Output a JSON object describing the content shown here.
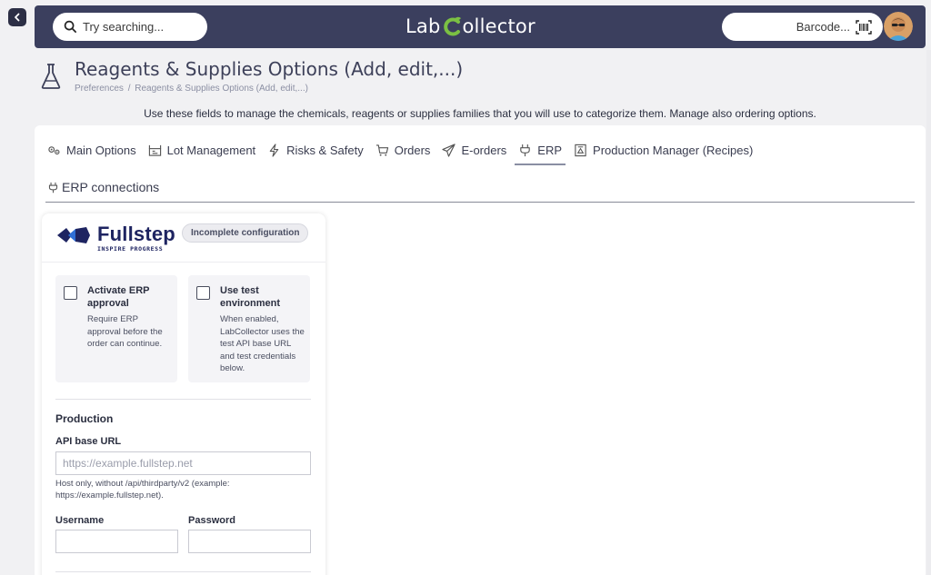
{
  "topbar": {
    "search_placeholder": "Try searching...",
    "logo_prefix": "Lab",
    "logo_suffix": "ollector",
    "barcode_placeholder": "Barcode..."
  },
  "page": {
    "title": "Reagents & Supplies Options (Add, edit,...)",
    "breadcrumb": [
      "Preferences",
      "/",
      "Reagents & Supplies Options (Add, edit,...)"
    ],
    "intro": "Use these fields to manage the chemicals, reagents or supplies families that you will use to categorize them. Manage also ordering options."
  },
  "tabs": [
    {
      "label": "Main Options",
      "icon": "gears-icon"
    },
    {
      "label": "Lot Management",
      "icon": "lot-icon"
    },
    {
      "label": "Risks & Safety",
      "icon": "lightning-icon"
    },
    {
      "label": "Orders",
      "icon": "cart-icon"
    },
    {
      "label": "E-orders",
      "icon": "paper-plane-icon"
    },
    {
      "label": "ERP",
      "icon": "plug-icon",
      "active": true
    },
    {
      "label": "Production Manager (Recipes)",
      "icon": "recipe-icon"
    }
  ],
  "subtab": {
    "label": "ERP connections",
    "icon": "plug-icon"
  },
  "erp": {
    "brand_name": "Fullstep",
    "brand_tagline": "INSPIRE PROGRESS",
    "badge": "Incomplete configuration",
    "options": [
      {
        "title": "Activate ERP approval",
        "description": "Require ERP approval before the order can continue.",
        "checked": false
      },
      {
        "title": "Use test environment",
        "description": "When enabled, LabCollector uses the test API base URL and test credentials below.",
        "checked": false
      }
    ],
    "production": {
      "section_title": "Production",
      "api_label": "API base URL",
      "api_placeholder": "https://example.fullstep.net",
      "api_hint": "Host only, without /api/thirdparty/v2 (example: https://example.fullstep.net).",
      "username_label": "Username",
      "password_label": "Password"
    }
  },
  "colors": {
    "topbar": "#3b3f5e",
    "accent_green": "#7bc043",
    "brand_navy": "#1e2461"
  }
}
